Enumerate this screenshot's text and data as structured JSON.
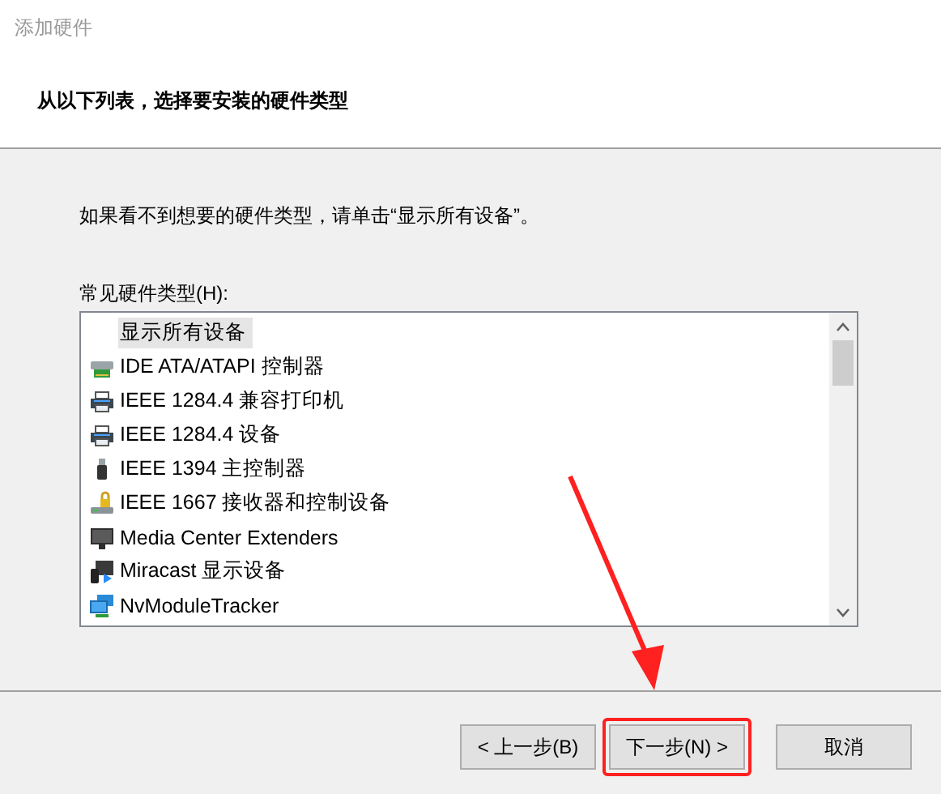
{
  "window": {
    "title": "添加硬件"
  },
  "header": {
    "heading": "从以下列表，选择要安装的硬件类型"
  },
  "instruction": "如果看不到想要的硬件类型，请单击“显示所有设备”。",
  "list_label": "常见硬件类型(H):",
  "hardware_types": [
    {
      "label": "显示所有设备",
      "kind": "none",
      "selected": true
    },
    {
      "label": "IDE ATA/ATAPI 控制器",
      "kind": "drive",
      "selected": false
    },
    {
      "label": "IEEE 1284.4 兼容打印机",
      "kind": "printer",
      "selected": false
    },
    {
      "label": "IEEE 1284.4 设备",
      "kind": "printer",
      "selected": false
    },
    {
      "label": "IEEE 1394 主控制器",
      "kind": "plug",
      "selected": false
    },
    {
      "label": "IEEE 1667 接收器和控制设备",
      "kind": "lock",
      "selected": false
    },
    {
      "label": "Media Center Extenders",
      "kind": "monitor",
      "selected": false
    },
    {
      "label": "Miracast 显示设备",
      "kind": "cast",
      "selected": false
    },
    {
      "label": "NvModuleTracker",
      "kind": "network",
      "selected": false
    }
  ],
  "buttons": [
    {
      "label": "< 上一步(B)",
      "highlighted": false
    },
    {
      "label": "下一步(N) >",
      "highlighted": true
    },
    {
      "label": "取消",
      "highlighted": false
    }
  ]
}
